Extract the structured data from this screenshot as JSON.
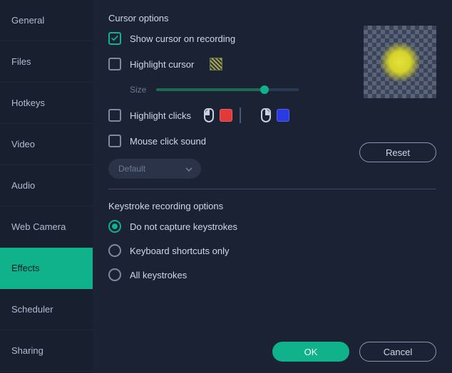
{
  "sidebar": {
    "items": [
      {
        "label": "General"
      },
      {
        "label": "Files"
      },
      {
        "label": "Hotkeys"
      },
      {
        "label": "Video"
      },
      {
        "label": "Audio"
      },
      {
        "label": "Web Camera"
      },
      {
        "label": "Effects"
      },
      {
        "label": "Scheduler"
      },
      {
        "label": "Sharing"
      }
    ],
    "active_index": 6
  },
  "cursor_options": {
    "title": "Cursor options",
    "show_cursor": {
      "label": "Show cursor on recording",
      "checked": true
    },
    "highlight_cursor": {
      "label": "Highlight cursor",
      "checked": false
    },
    "size_label": "Size",
    "size_value": 76,
    "highlight_clicks": {
      "label": "Highlight clicks",
      "checked": false,
      "left_color": "#e23a3a",
      "right_color": "#2a3be2"
    },
    "mouse_click_sound": {
      "label": "Mouse click sound",
      "checked": false
    },
    "sound_dropdown": {
      "value": "Default"
    },
    "reset_label": "Reset"
  },
  "keystroke_options": {
    "title": "Keystroke recording options",
    "selected_index": 0,
    "choices": [
      {
        "label": "Do not capture keystrokes"
      },
      {
        "label": "Keyboard shortcuts only"
      },
      {
        "label": "All keystrokes"
      }
    ]
  },
  "footer": {
    "ok": "OK",
    "cancel": "Cancel"
  }
}
